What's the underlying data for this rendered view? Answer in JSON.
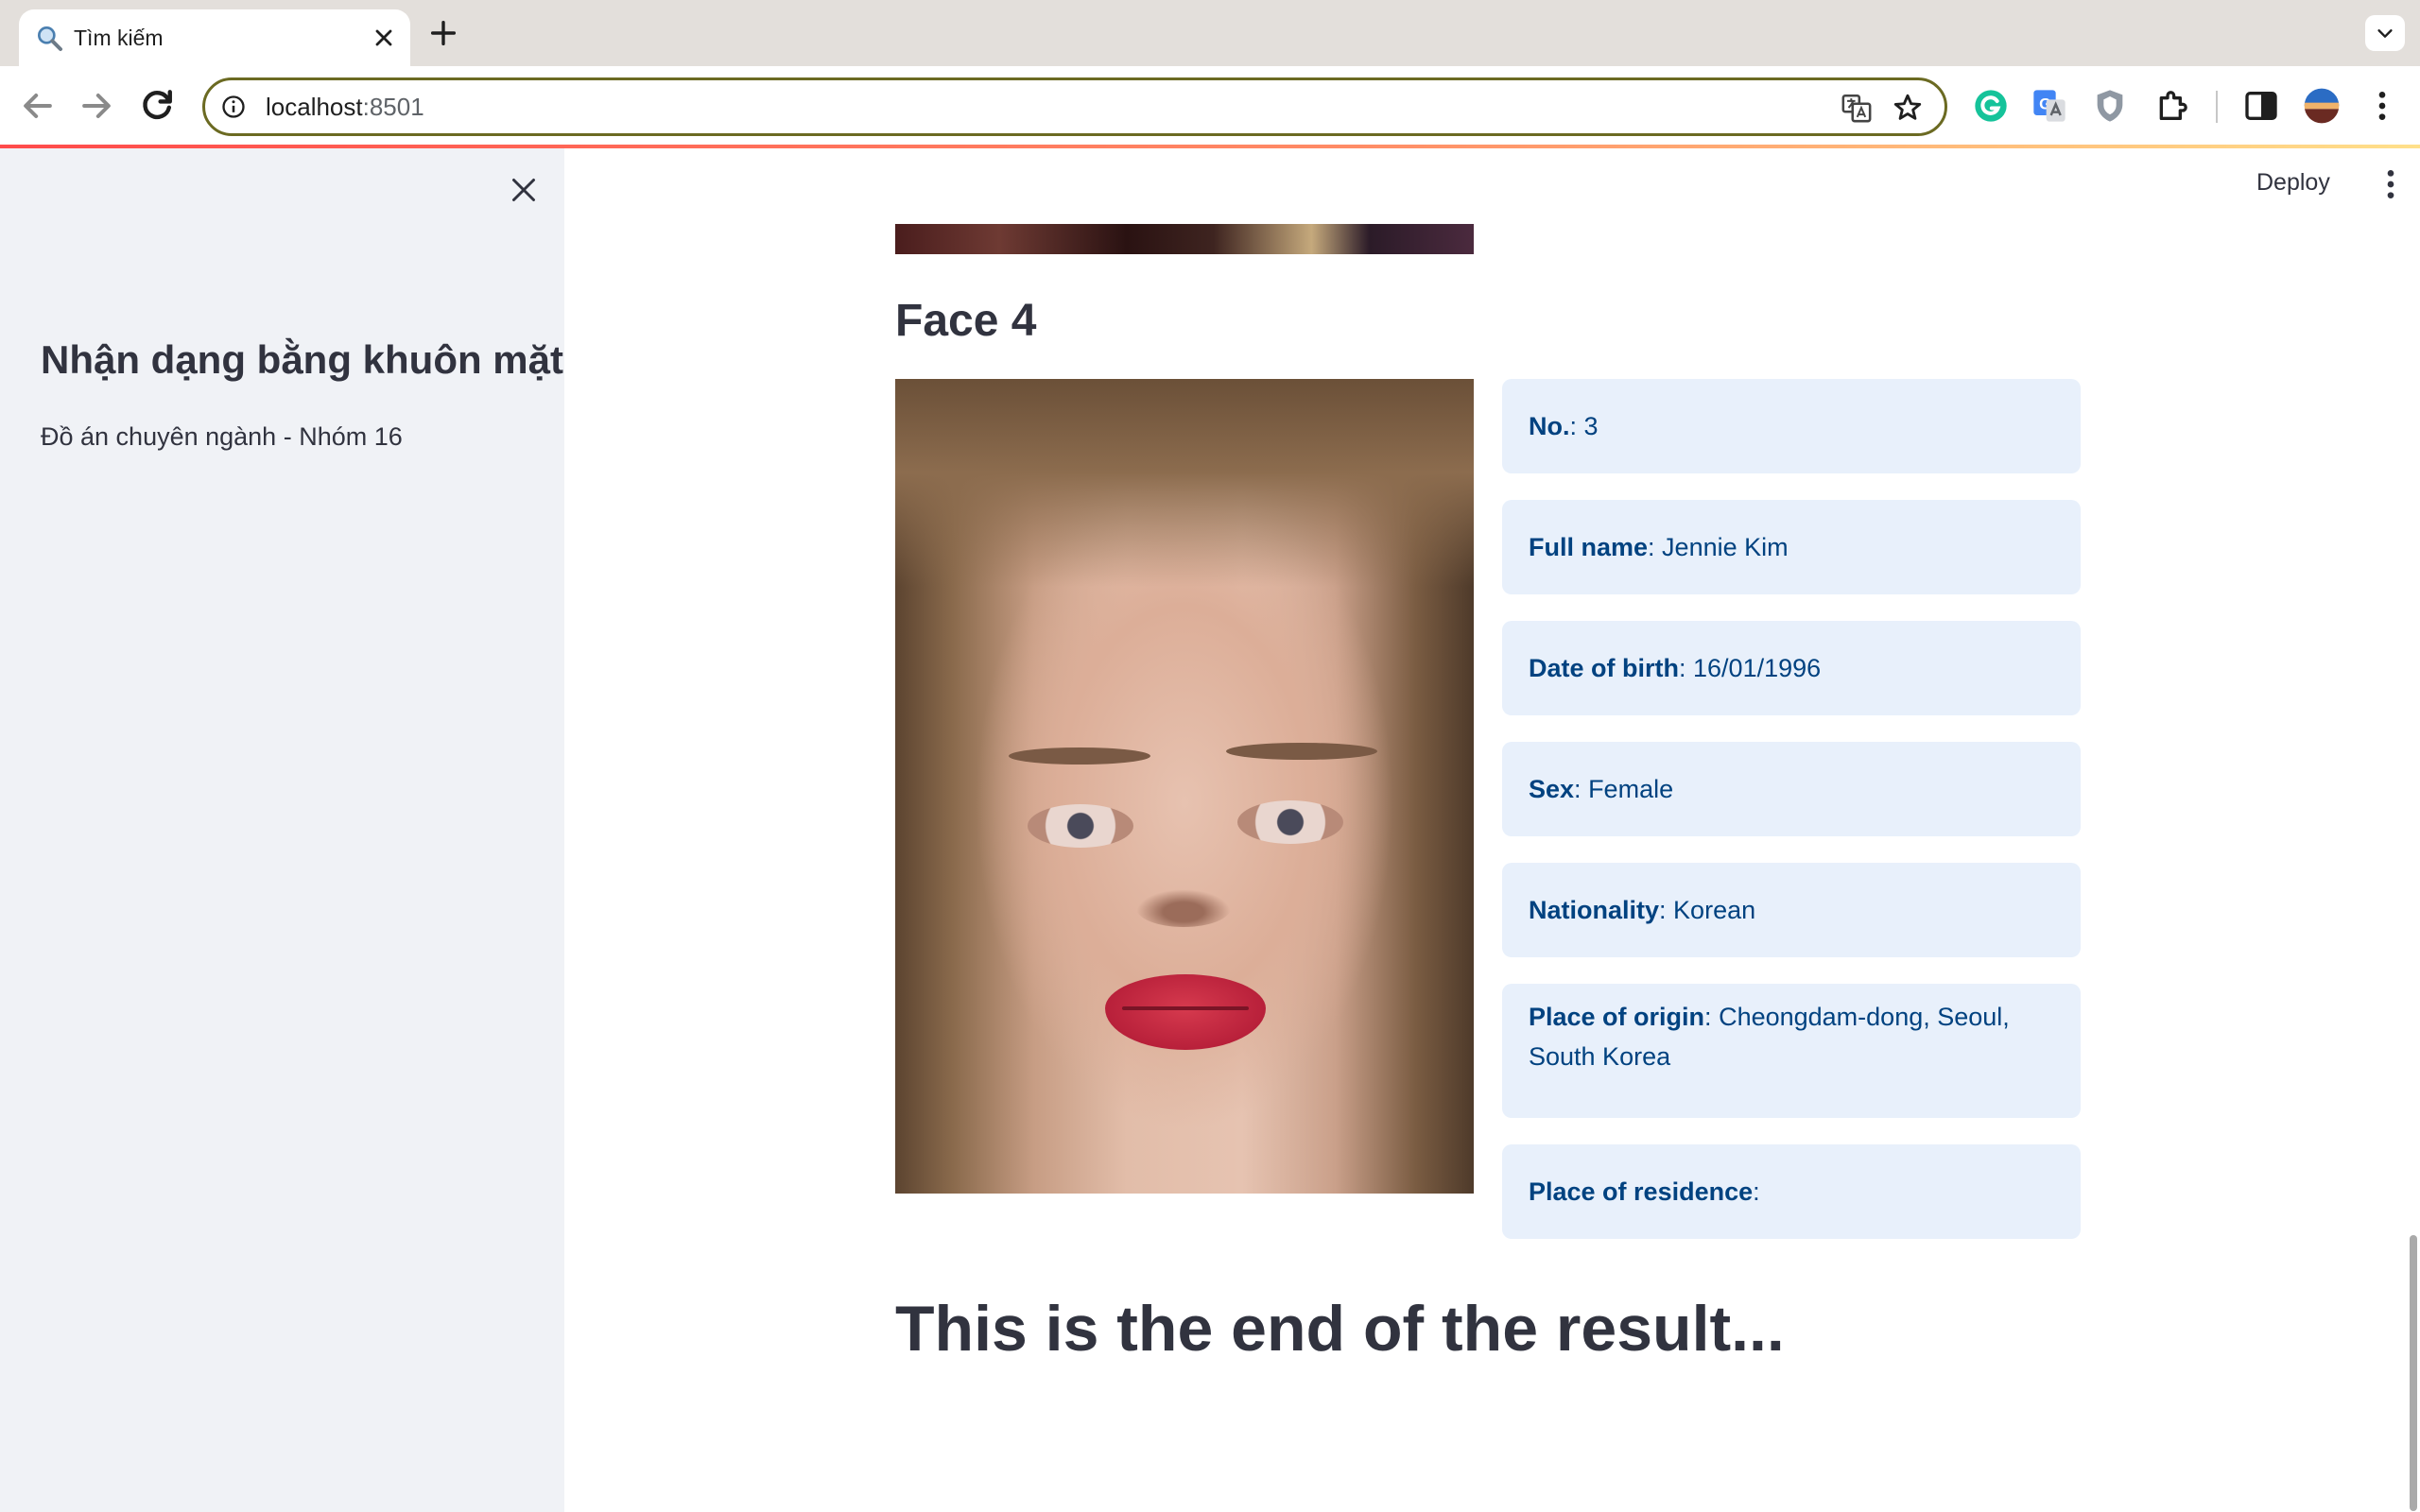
{
  "browser": {
    "tab": {
      "title": "Tìm kiếm",
      "icon": "search-icon"
    },
    "address": {
      "host": "localhost",
      "port": ":8501"
    }
  },
  "sidebar": {
    "title": "Nhận dạng bằng khuôn mặt",
    "caption": "Đồ án chuyên ngành - Nhóm 16"
  },
  "header": {
    "deploy_label": "Deploy"
  },
  "main": {
    "face_heading": "Face 4",
    "fields": [
      {
        "label": "No.",
        "value": " 3"
      },
      {
        "label": "Full name",
        "value": " Jennie Kim"
      },
      {
        "label": "Date of birth",
        "value": " 16/01/1996"
      },
      {
        "label": "Sex",
        "value": " Female"
      },
      {
        "label": "Nationality",
        "value": " Korean"
      },
      {
        "label": "Place of origin",
        "value": " Cheongdam-dong, Seoul, South Korea"
      },
      {
        "label": "Place of residence",
        "value": ""
      }
    ],
    "end_heading": "This is the end of the result..."
  },
  "colors": {
    "sidebar_bg": "#f0f2f6",
    "info_card_bg": "#e8f0fb",
    "info_card_text": "#004280",
    "heading_text": "#31333f",
    "omnibox_border": "#6b6a22"
  }
}
